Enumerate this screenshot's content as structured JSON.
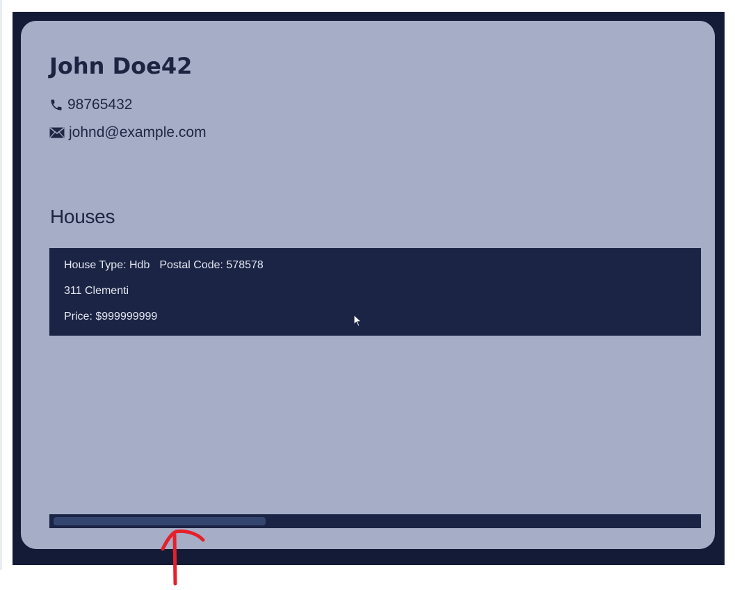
{
  "profile": {
    "name": "John Doe42",
    "phone": "98765432",
    "email": "johnd@example.com"
  },
  "houses_section": {
    "title": "Houses",
    "items": [
      {
        "house_type": "House Type: Hdb",
        "postal_code": "Postal Code: 578578",
        "address": "311 Clementi",
        "price": "Price: $999999999"
      }
    ]
  },
  "icons": {
    "phone": "phone-icon",
    "email": "envelope-icon",
    "cursor": "mouse-pointer-icon"
  },
  "scrollbar": {
    "thumb_position_fraction": 0.0,
    "visible_fraction": 0.33
  },
  "colors": {
    "background": "#131b36",
    "card": "#a5aec6",
    "house_card": "#1b2444",
    "text_dark": "#1c2442",
    "text_light": "#e3e7f1",
    "annotation": "#e5202b"
  }
}
